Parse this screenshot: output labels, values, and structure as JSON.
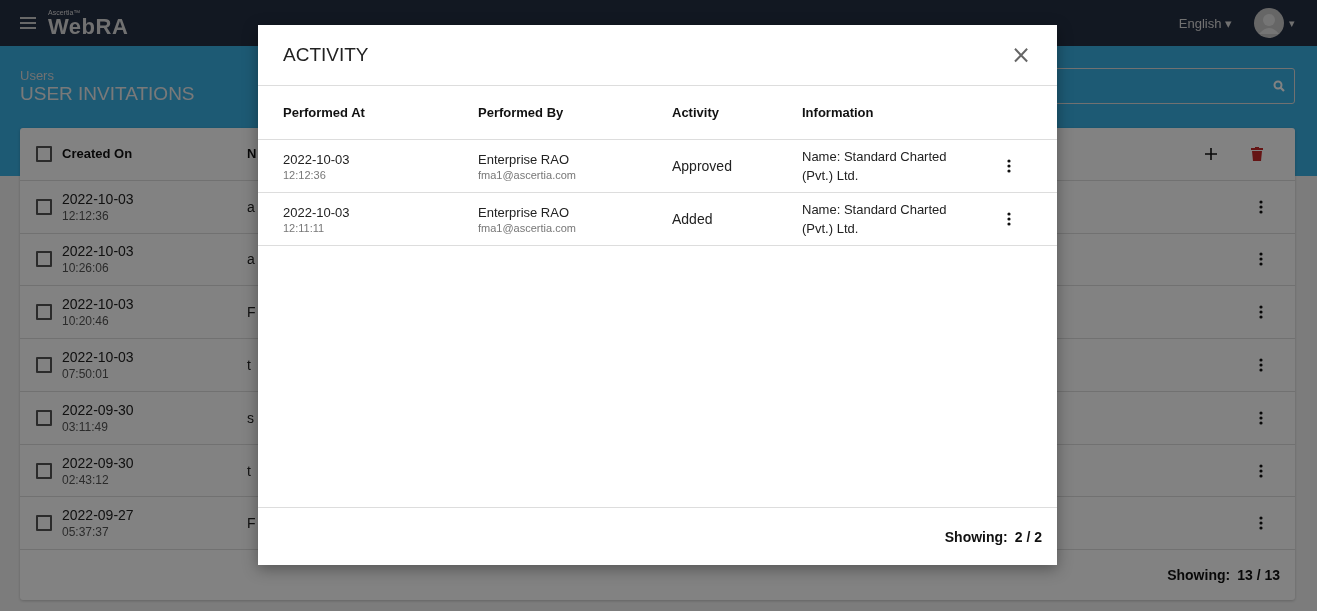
{
  "app": {
    "brand_small": "Ascertia™",
    "brand": "WebRA",
    "language": "English ▾",
    "user_caret": "▾"
  },
  "page": {
    "breadcrumb": "Users",
    "title": "USER INVITATIONS"
  },
  "table": {
    "select_all": {
      "checked": false
    },
    "columns": [
      "Created On",
      "N"
    ],
    "rows": [
      {
        "checked": false,
        "date": "2022-10-03",
        "time": "12:12:36",
        "column_2": "a"
      },
      {
        "checked": false,
        "date": "2022-10-03",
        "time": "10:26:06",
        "column_2": "a"
      },
      {
        "checked": false,
        "date": "2022-10-03",
        "time": "10:20:46",
        "column_2": "F"
      },
      {
        "checked": false,
        "date": "2022-10-03",
        "time": "07:50:01",
        "column_2": "t"
      },
      {
        "checked": false,
        "date": "2022-09-30",
        "time": "03:11:49",
        "column_2": "s"
      },
      {
        "checked": false,
        "date": "2022-09-30",
        "time": "02:43:12",
        "column_2": "t"
      },
      {
        "checked": false,
        "date": "2022-09-27",
        "time": "05:37:37",
        "column_2": "F"
      }
    ],
    "footer": {
      "label": "Showing:",
      "value": "13 / 13"
    }
  },
  "dialog": {
    "title": "ACTIVITY",
    "close": "×",
    "columns": [
      "Performed At",
      "Performed By",
      "Activity",
      "Information"
    ],
    "rows": [
      {
        "date": "2022-10-03",
        "time": "12:12:36",
        "by": "Enterprise RAO",
        "email": "fma1@ascertia.com",
        "activity": "Approved",
        "info": "Name: Standard Charted (Pvt.) Ltd."
      },
      {
        "date": "2022-10-03",
        "time": "12:11:11",
        "by": "Enterprise RAO",
        "email": "fma1@ascertia.com",
        "activity": "Added",
        "info": "Name: Standard Charted (Pvt.) Ltd."
      }
    ],
    "footer": {
      "label": "Showing:",
      "value": "2 / 2"
    }
  }
}
